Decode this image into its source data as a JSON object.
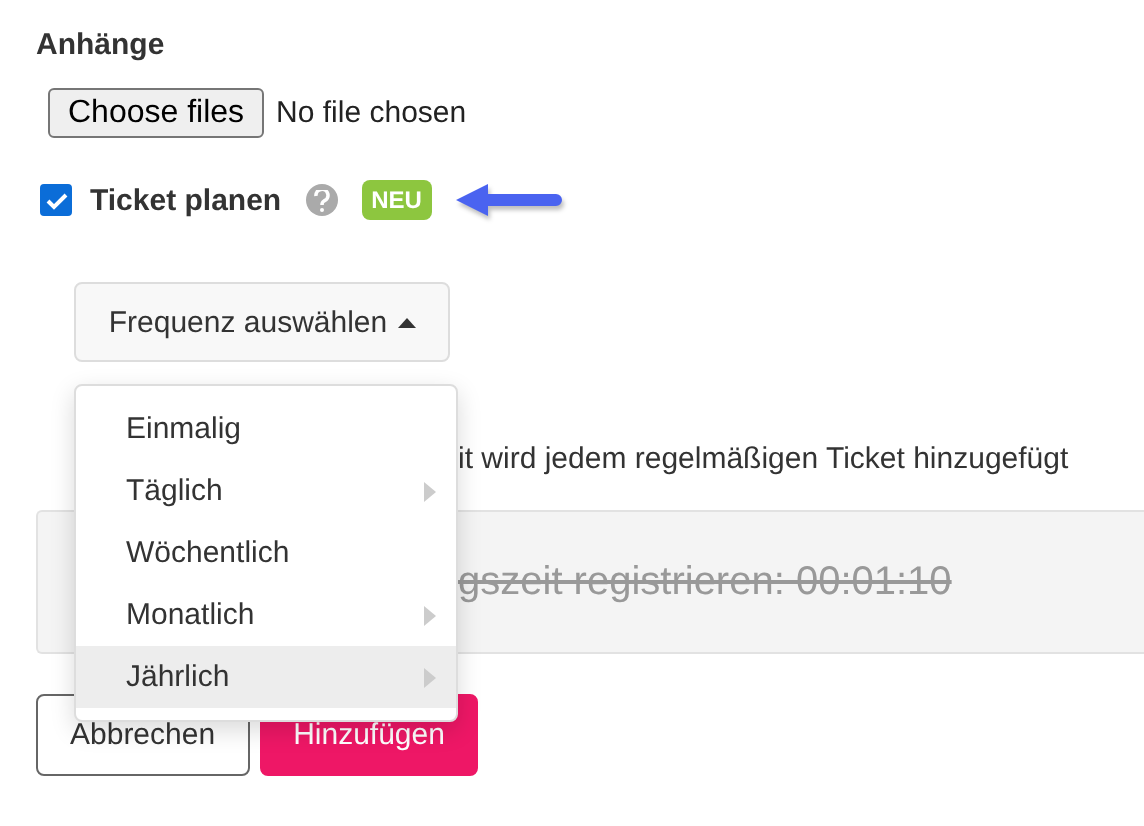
{
  "attachments": {
    "heading": "Anhänge",
    "file_button": "Choose files",
    "file_status": "No file chosen"
  },
  "schedule": {
    "label": "Ticket planen",
    "checked": true,
    "badge": "NEU"
  },
  "frequency_button": {
    "label": "Frequenz auswählen",
    "expanded": true
  },
  "frequency_menu": [
    {
      "label": "Einmalig",
      "submenu": false,
      "highlighted": false
    },
    {
      "label": "Täglich",
      "submenu": true,
      "highlighted": false
    },
    {
      "label": "Wöchentlich",
      "submenu": false,
      "highlighted": false
    },
    {
      "label": "Monatlich",
      "submenu": true,
      "highlighted": false
    },
    {
      "label": "Jährlich",
      "submenu": true,
      "highlighted": true
    }
  ],
  "info_text": "it wird jedem regelmäßigen Ticket hinzugefügt",
  "time_entry": {
    "text": "gszeit registrieren: 00:01:10",
    "struck": true
  },
  "buttons": [
    {
      "label": "Abbrechen",
      "kind": "secondary"
    },
    {
      "label": "Hinzufügen",
      "kind": "primary"
    }
  ]
}
